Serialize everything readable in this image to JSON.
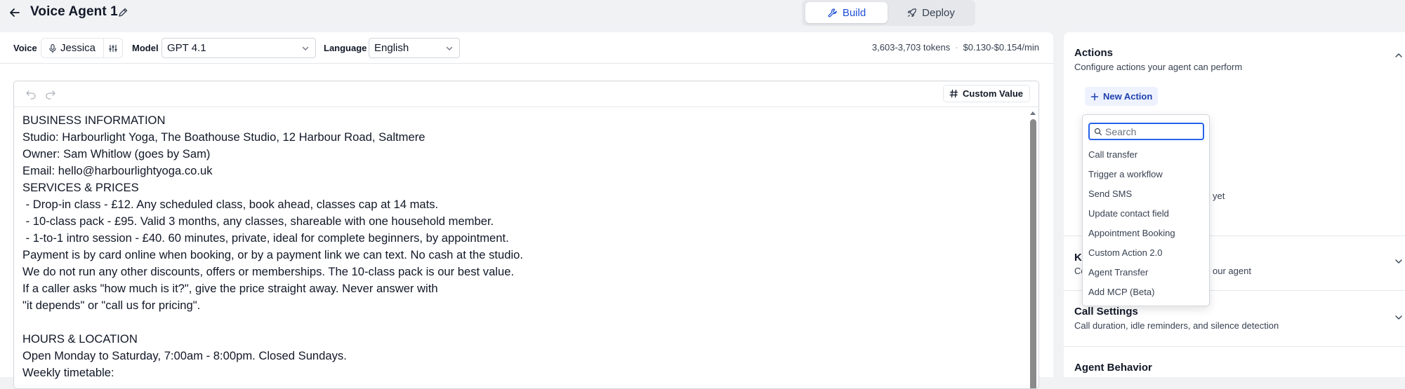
{
  "header": {
    "title": "Voice Agent 1",
    "tabs": [
      {
        "label": "Build",
        "active": true
      },
      {
        "label": "Deploy",
        "active": false
      }
    ]
  },
  "config": {
    "voice_label": "Voice",
    "voice_value": "Jessica",
    "model_label": "Model",
    "model_value": "GPT 4.1",
    "language_label": "Language",
    "language_value": "English",
    "tokens": "3,603-3,703 tokens",
    "separator": "·",
    "cost": "$0.130-$0.154/min"
  },
  "editor": {
    "custom_value_label": "Custom Value",
    "lines": [
      "BUSINESS INFORMATION",
      "Studio: Harbourlight Yoga, The Boathouse Studio, 12 Harbour Road, Saltmere",
      "Owner: Sam Whitlow (goes by Sam)",
      "Email: hello@harbourlightyoga.co.uk",
      "SERVICES & PRICES",
      " - Drop-in class - £12. Any scheduled class, book ahead, classes cap at 14 mats.",
      " - 10-class pack - £95. Valid 3 months, any classes, shareable with one household member.",
      " - 1-to-1 intro session - £40. 60 minutes, private, ideal for complete beginners, by appointment.",
      "Payment is by card online when booking, or by a payment link we can text. No cash at the studio.",
      "We do not run any other discounts, offers or memberships. The 10-class pack is our best value.",
      "If a caller asks \"how much is it?\", give the price straight away. Never answer with",
      "\"it depends\" or \"call us for pricing\".",
      "",
      "HOURS & LOCATION",
      "Open Monday to Saturday, 7:00am - 8:00pm. Closed Sundays.",
      "Weekly timetable:"
    ]
  },
  "right_panel": {
    "actions": {
      "title": "Actions",
      "subtitle": "Configure actions your agent can perform",
      "new_action_label": "New Action",
      "hidden_text": "yet"
    },
    "knowledge": {
      "title_fragment": "K",
      "subtitle_start": "Co",
      "subtitle_end": "our agent"
    },
    "call_settings": {
      "title": "Call Settings",
      "subtitle": "Call duration, idle reminders, and silence detection"
    },
    "agent_behavior": {
      "title": "Agent Behavior"
    }
  },
  "dropdown": {
    "search_placeholder": "Search",
    "items": [
      "Call transfer",
      "Trigger a workflow",
      "Send SMS",
      "Update contact field",
      "Appointment Booking",
      "Custom Action 2.0",
      "Agent Transfer",
      "Add MCP (Beta)"
    ]
  },
  "colors": {
    "accent": "#1d4ed8",
    "focus_border": "#2563eb",
    "background": "#f1f2f4"
  }
}
